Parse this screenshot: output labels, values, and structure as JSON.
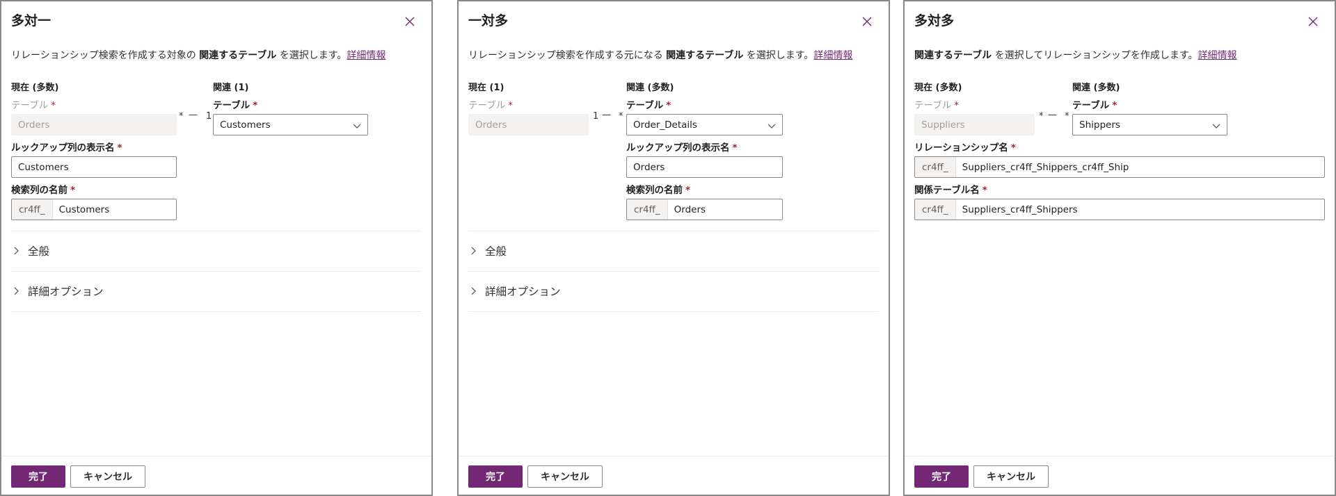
{
  "panels": [
    {
      "title": "多対一",
      "description": {
        "before": "リレーションシップ検索を作成する対象の ",
        "bold": "関連するテーブル",
        "after": " を選択します。",
        "link": "詳細情報"
      },
      "current_heading": "現在 (多数)",
      "related_heading": "関連 (1)",
      "current_table_label": "テーブル",
      "current_table_value": "Orders",
      "cardinality_left": "*",
      "cardinality_right": "1",
      "related_table_label": "テーブル",
      "related_table_value": "Customers",
      "lookup_display_label": "ルックアップ列の表示名",
      "lookup_display_value": "Customers",
      "lookup_name_label": "検索列の名前",
      "lookup_name_prefix": "cr4ff_",
      "lookup_name_value": "Customers",
      "section_general": "全般",
      "section_advanced": "詳細オプション",
      "done_label": "完了",
      "cancel_label": "キャンセル"
    },
    {
      "title": "一対多",
      "description": {
        "before": "リレーションシップ検索を作成する元になる ",
        "bold": "関連するテーブル",
        "after": " を選択します。",
        "link": "詳細情報"
      },
      "current_heading": "現在 (1)",
      "related_heading": "関連 (多数)",
      "current_table_label": "テーブル",
      "current_table_value": "Orders",
      "cardinality_left": "1",
      "cardinality_right": "*",
      "related_table_label": "テーブル",
      "related_table_value": "Order_Details",
      "lookup_display_label": "ルックアップ列の表示名",
      "lookup_display_value": "Orders",
      "lookup_name_label": "検索列の名前",
      "lookup_name_prefix": "cr4ff_",
      "lookup_name_value": "Orders",
      "section_general": "全般",
      "section_advanced": "詳細オプション",
      "done_label": "完了",
      "cancel_label": "キャンセル"
    },
    {
      "title": "多対多",
      "description": {
        "before": "",
        "bold": "関連するテーブル",
        "after": " を選択してリレーションシップを作成します。",
        "link": "詳細情報"
      },
      "current_heading": "現在 (多数)",
      "related_heading": "関連 (多数)",
      "current_table_label": "テーブル",
      "current_table_value": "Suppliers",
      "cardinality_left": "*",
      "cardinality_right": "*",
      "related_table_label": "テーブル",
      "related_table_value": "Shippers",
      "relationship_name_label": "リレーションシップ名",
      "relationship_name_prefix": "cr4ff_",
      "relationship_name_value": "Suppliers_cr4ff_Shippers_cr4ff_Ship",
      "relationship_table_label": "関係テーブル名",
      "relationship_table_prefix": "cr4ff_",
      "relationship_table_value": "Suppliers_cr4ff_Shippers",
      "done_label": "完了",
      "cancel_label": "キャンセル"
    }
  ],
  "colors": {
    "accent": "#742774",
    "required": "#a4262c",
    "disabled_bg": "#f3f2f1"
  }
}
